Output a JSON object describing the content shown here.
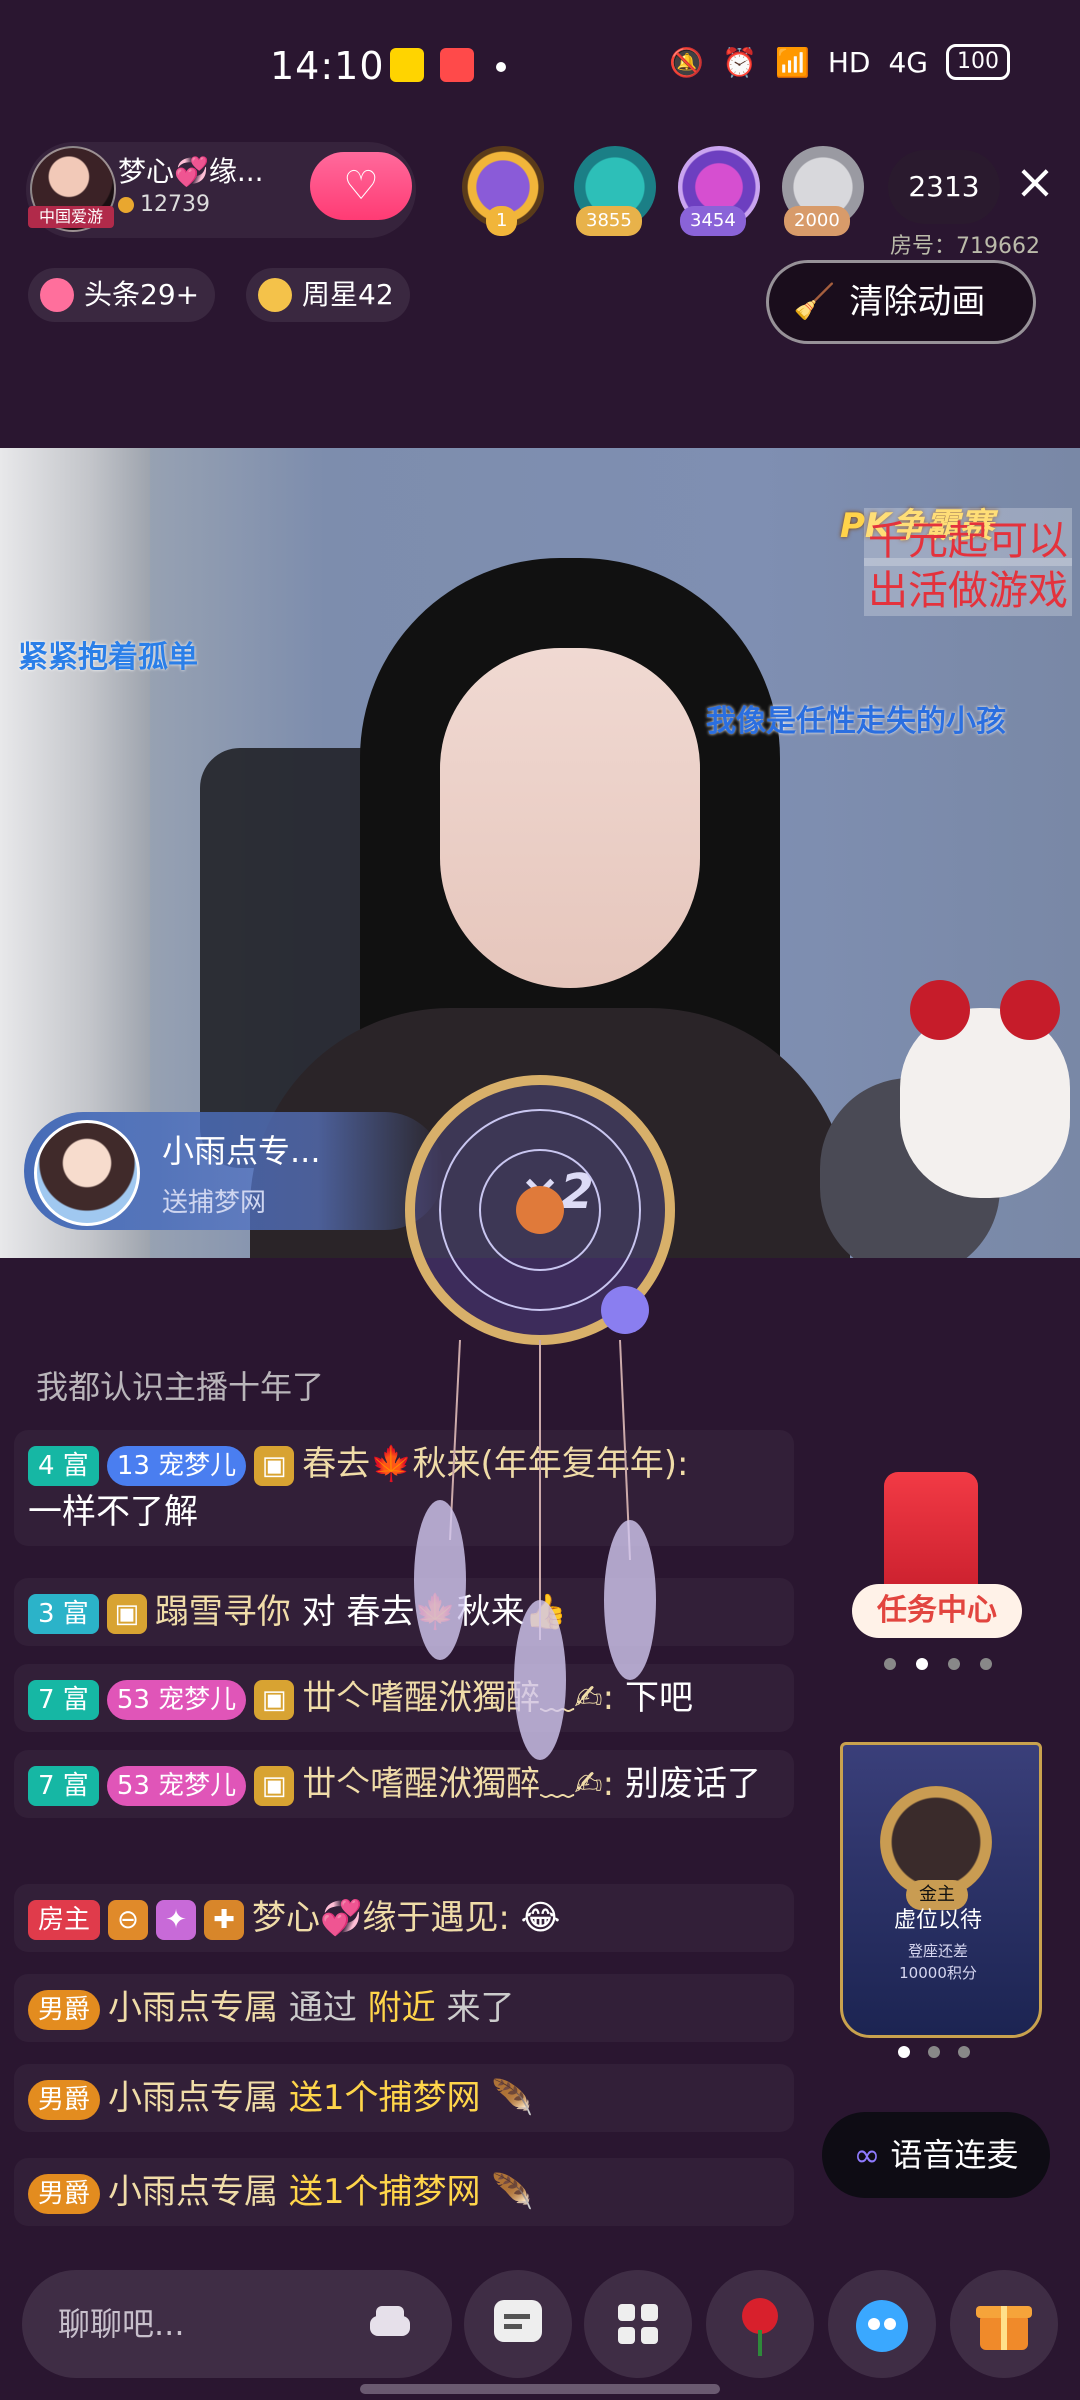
{
  "status_bar": {
    "time": "14:10",
    "network": "HD",
    "signal": "4G",
    "battery": "100"
  },
  "host": {
    "name": "梦心💞缘...",
    "score": "12739",
    "avatar_tag": "中国爱游"
  },
  "viewers": [
    {
      "tag": "1",
      "color": "#f1b53a"
    },
    {
      "tag": "3855",
      "color": "#e8b24a"
    },
    {
      "tag": "3454",
      "color": "#8a63d8"
    },
    {
      "tag": "2000",
      "color": "#d89b6a"
    }
  ],
  "online_count": "2313",
  "room_number": "房号：719662",
  "chips": {
    "headline": "头条29+",
    "weekly_star": "周星42"
  },
  "clear_animation_label": "清除动画",
  "video_overlay": {
    "pk_title": "PK争霸赛",
    "pk_line1": "千元起可以",
    "pk_line2": "出活做游戏",
    "left_text": "紧紧抱着孤单",
    "right_text": "我像是任性走失的小孩"
  },
  "gift_banner": {
    "sender": "小雨点专...",
    "gift": "送捕梦网",
    "multiplier": "×2"
  },
  "chat": {
    "partial_line": "我都认识主播十年了",
    "messages": [
      {
        "badge": "4 富",
        "pet": "宠梦儿",
        "pet_level": "13",
        "name": "春去🍁秋来(年年复年年):",
        "text": "一样不了解"
      },
      {
        "badge": "3 富",
        "name": "蹋雪寻你",
        "text": "对 春去🍁秋来👍"
      },
      {
        "badge": "7 富",
        "pet": "宠梦儿",
        "pet_level": "53",
        "name": "丗亽嗜醒洑獨醉﹏✍:",
        "text": "下吧"
      },
      {
        "badge": "7 富",
        "pet": "宠梦儿",
        "pet_level": "53",
        "name": "丗亽嗜醒洑獨醉﹏✍:",
        "text": "别废话了"
      },
      {
        "badge": "房主",
        "name": "梦心💞缘于遇见:",
        "text": "😂"
      },
      {
        "badge": "男爵",
        "name": "小雨点专属",
        "mid": "通过",
        "highlight": "附近",
        "text": "来了"
      },
      {
        "badge": "男爵",
        "name": "小雨点专属",
        "highlight": "送1个捕梦网"
      },
      {
        "badge": "男爵",
        "name": "小雨点专属",
        "highlight": "送1个捕梦网"
      }
    ]
  },
  "task_center_label": "任务中心",
  "seat": {
    "tag": "金主",
    "title": "虚位以待",
    "line1": "登座还差",
    "line2": "10000积分"
  },
  "voice_link_label": "语音连麦",
  "input_placeholder": "聊聊吧...",
  "colors": {
    "background": "#2a1630",
    "accent_pink": "#ff3b74",
    "gold": "#ffd54a"
  }
}
